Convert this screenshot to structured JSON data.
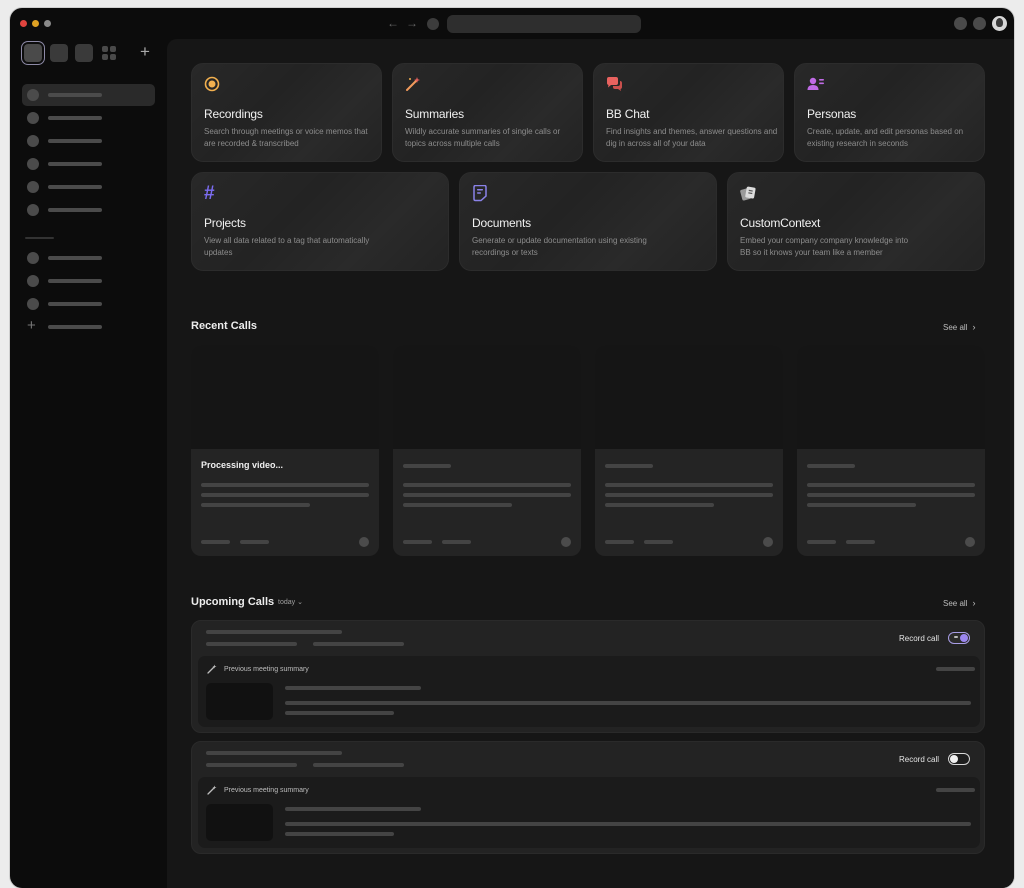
{
  "titlebar": {
    "back_icon": "arrow-left-icon",
    "forward_icon": "arrow-right-icon",
    "back_glyph": "←",
    "forward_glyph": "→"
  },
  "sidebar": {
    "add_workspace_glyph": "+",
    "new_item_glyph": "+"
  },
  "features": [
    {
      "title": "Recordings",
      "description": "Search through meetings or voice memos that are recorded & transcribed",
      "icon": "record-icon",
      "color": "#f2b04f"
    },
    {
      "title": "Summaries",
      "description": "Wildly accurate summaries of single calls or topics across multiple calls",
      "icon": "magic-wand-icon",
      "color": "#f09a5c"
    },
    {
      "title": "BB Chat",
      "description": "Find insights and themes, answer questions and dig in across all of your data",
      "icon": "chat-bubbles-icon",
      "color": "#e8625f"
    },
    {
      "title": "Personas",
      "description": "Create, update, and edit personas based on existing research in seconds",
      "icon": "persona-icon",
      "color": "#c06be6"
    },
    {
      "title": "Projects",
      "description": "View all data related to a tag that automatically updates",
      "icon": "hashtag-icon",
      "color": "#7b6cf0",
      "glyph": "#"
    },
    {
      "title": "Documents",
      "description": "Generate or update documentation using existing recordings or texts",
      "icon": "document-icon",
      "color": "#8a82e8"
    },
    {
      "title": "CustomContext",
      "description": "Embed your company company knowledge into BB so it knows your team like a member",
      "icon": "context-cards-icon",
      "color": "#d8d8d8"
    }
  ],
  "recent_calls": {
    "title": "Recent Calls",
    "see_all": "See all",
    "chevron": "›",
    "first_card_title": "Processing video..."
  },
  "upcoming_calls": {
    "title": "Upcoming Calls",
    "filter": "today",
    "filter_chevron": "⌄",
    "see_all": "See all",
    "chevron": "›",
    "items": [
      {
        "record_label": "Record call",
        "record_on": true,
        "previous_summary_label": "Previous meeting summary"
      },
      {
        "record_label": "Record call",
        "record_on": false,
        "previous_summary_label": "Previous meeting summary"
      }
    ]
  }
}
